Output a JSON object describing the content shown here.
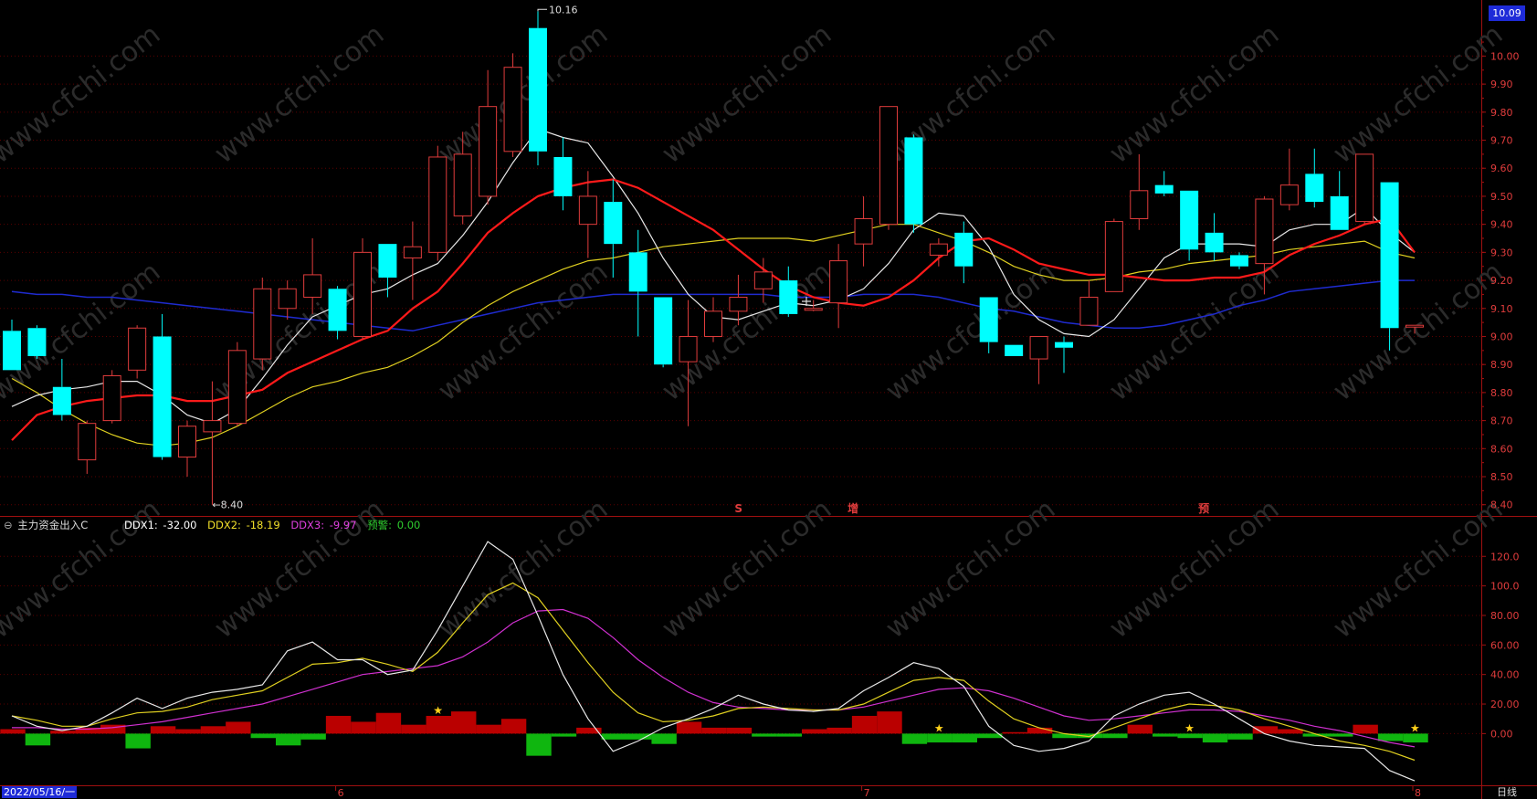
{
  "chart_data": [
    {
      "type": "candlestick",
      "price_axis": {
        "ticks": [
          "10.00",
          "9.90",
          "9.80",
          "9.70",
          "9.60",
          "9.50",
          "9.40",
          "9.30",
          "9.20",
          "9.10",
          "9.00",
          "8.90",
          "8.80",
          "8.70",
          "8.60",
          "8.50",
          "8.40"
        ],
        "range": [
          8.36,
          10.2
        ]
      },
      "current_price_label": "10.09",
      "max_marker": "10.16",
      "min_marker": "8.40",
      "candles": [
        {
          "o": 9.02,
          "h": 9.06,
          "l": 8.88,
          "c": 8.88
        },
        {
          "o": 9.03,
          "h": 9.04,
          "l": 8.92,
          "c": 8.93
        },
        {
          "o": 8.82,
          "h": 8.92,
          "l": 8.7,
          "c": 8.72
        },
        {
          "o": 8.56,
          "h": 8.7,
          "l": 8.51,
          "c": 8.69
        },
        {
          "o": 8.7,
          "h": 8.88,
          "l": 8.69,
          "c": 8.86
        },
        {
          "o": 8.88,
          "h": 9.04,
          "l": 8.85,
          "c": 9.03
        },
        {
          "o": 9.0,
          "h": 9.08,
          "l": 8.56,
          "c": 8.57
        },
        {
          "o": 8.57,
          "h": 8.7,
          "l": 8.5,
          "c": 8.68
        },
        {
          "o": 8.66,
          "h": 8.84,
          "l": 8.4,
          "c": 8.7
        },
        {
          "o": 8.69,
          "h": 8.98,
          "l": 8.68,
          "c": 8.95
        },
        {
          "o": 8.92,
          "h": 9.21,
          "l": 8.88,
          "c": 9.17
        },
        {
          "o": 9.1,
          "h": 9.2,
          "l": 9.06,
          "c": 9.17
        },
        {
          "o": 9.14,
          "h": 9.35,
          "l": 9.08,
          "c": 9.22
        },
        {
          "o": 9.17,
          "h": 9.18,
          "l": 8.99,
          "c": 9.02
        },
        {
          "o": 9.0,
          "h": 9.35,
          "l": 8.99,
          "c": 9.3
        },
        {
          "o": 9.33,
          "h": 9.33,
          "l": 9.14,
          "c": 9.21
        },
        {
          "o": 9.28,
          "h": 9.41,
          "l": 9.13,
          "c": 9.32
        },
        {
          "o": 9.3,
          "h": 9.68,
          "l": 9.27,
          "c": 9.64
        },
        {
          "o": 9.43,
          "h": 9.73,
          "l": 9.4,
          "c": 9.65
        },
        {
          "o": 9.5,
          "h": 9.95,
          "l": 9.47,
          "c": 9.82
        },
        {
          "o": 9.66,
          "h": 10.01,
          "l": 9.64,
          "c": 9.96
        },
        {
          "o": 10.1,
          "h": 10.16,
          "l": 9.61,
          "c": 9.66
        },
        {
          "o": 9.64,
          "h": 9.71,
          "l": 9.45,
          "c": 9.5
        },
        {
          "o": 9.4,
          "h": 9.59,
          "l": 9.28,
          "c": 9.5
        },
        {
          "o": 9.48,
          "h": 9.56,
          "l": 9.21,
          "c": 9.33
        },
        {
          "o": 9.3,
          "h": 9.38,
          "l": 9.0,
          "c": 9.16
        },
        {
          "o": 9.14,
          "h": 9.14,
          "l": 8.89,
          "c": 8.9
        },
        {
          "o": 8.91,
          "h": 9.13,
          "l": 8.68,
          "c": 9.0
        },
        {
          "o": 9.0,
          "h": 9.14,
          "l": 8.98,
          "c": 9.09
        },
        {
          "o": 9.09,
          "h": 9.22,
          "l": 9.04,
          "c": 9.14
        },
        {
          "o": 9.17,
          "h": 9.28,
          "l": 9.12,
          "c": 9.23
        },
        {
          "o": 9.2,
          "h": 9.25,
          "l": 9.07,
          "c": 9.08
        },
        {
          "o": 9.1,
          "h": 9.13,
          "l": 9.09,
          "c": 9.1
        },
        {
          "o": 9.12,
          "h": 9.33,
          "l": 9.03,
          "c": 9.27
        },
        {
          "o": 9.33,
          "h": 9.5,
          "l": 9.25,
          "c": 9.42
        },
        {
          "o": 9.4,
          "h": 9.82,
          "l": 9.38,
          "c": 9.82
        },
        {
          "o": 9.71,
          "h": 9.72,
          "l": 9.37,
          "c": 9.4
        },
        {
          "o": 9.29,
          "h": 9.35,
          "l": 9.25,
          "c": 9.33
        },
        {
          "o": 9.37,
          "h": 9.41,
          "l": 9.19,
          "c": 9.25
        },
        {
          "o": 9.14,
          "h": 9.14,
          "l": 8.94,
          "c": 8.98
        },
        {
          "o": 8.97,
          "h": 8.97,
          "l": 8.93,
          "c": 8.93
        },
        {
          "o": 8.92,
          "h": 9.0,
          "l": 8.83,
          "c": 9.0
        },
        {
          "o": 8.98,
          "h": 9.0,
          "l": 8.87,
          "c": 8.96
        },
        {
          "o": 9.04,
          "h": 9.2,
          "l": 9.04,
          "c": 9.14
        },
        {
          "o": 9.16,
          "h": 9.42,
          "l": 9.16,
          "c": 9.41
        },
        {
          "o": 9.42,
          "h": 9.65,
          "l": 9.38,
          "c": 9.52
        },
        {
          "o": 9.54,
          "h": 9.59,
          "l": 9.5,
          "c": 9.51
        },
        {
          "o": 9.52,
          "h": 9.52,
          "l": 9.27,
          "c": 9.31
        },
        {
          "o": 9.37,
          "h": 9.44,
          "l": 9.27,
          "c": 9.3
        },
        {
          "o": 9.29,
          "h": 9.3,
          "l": 9.24,
          "c": 9.25
        },
        {
          "o": 9.26,
          "h": 9.5,
          "l": 9.15,
          "c": 9.49
        },
        {
          "o": 9.47,
          "h": 9.67,
          "l": 9.45,
          "c": 9.54
        },
        {
          "o": 9.58,
          "h": 9.67,
          "l": 9.46,
          "c": 9.48
        },
        {
          "o": 9.5,
          "h": 9.59,
          "l": 9.38,
          "c": 9.38
        },
        {
          "o": 9.41,
          "h": 9.65,
          "l": 9.4,
          "c": 9.65
        },
        {
          "o": 9.55,
          "h": 9.55,
          "l": 8.95,
          "c": 9.03
        },
        {
          "o": 9.04,
          "h": 9.04,
          "l": 9.01,
          "c": 9.04
        }
      ],
      "ma_white": [
        8.75,
        8.79,
        8.81,
        8.82,
        8.84,
        8.84,
        8.79,
        8.72,
        8.69,
        8.74,
        8.85,
        8.97,
        9.07,
        9.11,
        9.15,
        9.17,
        9.22,
        9.26,
        9.36,
        9.48,
        9.62,
        9.74,
        9.71,
        9.69,
        9.57,
        9.44,
        9.28,
        9.15,
        9.07,
        9.06,
        9.09,
        9.12,
        9.11,
        9.13,
        9.17,
        9.26,
        9.38,
        9.44,
        9.43,
        9.32,
        9.15,
        9.06,
        9.01,
        9.0,
        9.06,
        9.17,
        9.28,
        9.33,
        9.33,
        9.33,
        9.32,
        9.38,
        9.4,
        9.4,
        9.46,
        9.37,
        9.3
      ],
      "ma_red": [
        8.63,
        8.72,
        8.75,
        8.77,
        8.78,
        8.79,
        8.79,
        8.77,
        8.77,
        8.79,
        8.81,
        8.87,
        8.91,
        8.95,
        8.99,
        9.02,
        9.1,
        9.16,
        9.26,
        9.37,
        9.44,
        9.5,
        9.53,
        9.55,
        9.56,
        9.53,
        9.48,
        9.43,
        9.38,
        9.31,
        9.24,
        9.18,
        9.14,
        9.12,
        9.11,
        9.14,
        9.2,
        9.28,
        9.34,
        9.35,
        9.31,
        9.26,
        9.24,
        9.22,
        9.22,
        9.21,
        9.2,
        9.2,
        9.21,
        9.21,
        9.23,
        9.29,
        9.33,
        9.36,
        9.4,
        9.42,
        9.3
      ],
      "ma_yellow": [
        8.85,
        8.8,
        8.74,
        8.69,
        8.65,
        8.62,
        8.61,
        8.62,
        8.64,
        8.68,
        8.73,
        8.78,
        8.82,
        8.84,
        8.87,
        8.89,
        8.93,
        8.98,
        9.05,
        9.11,
        9.16,
        9.2,
        9.24,
        9.27,
        9.28,
        9.3,
        9.32,
        9.33,
        9.34,
        9.35,
        9.35,
        9.35,
        9.34,
        9.36,
        9.38,
        9.4,
        9.4,
        9.37,
        9.34,
        9.3,
        9.25,
        9.22,
        9.2,
        9.2,
        9.21,
        9.23,
        9.24,
        9.26,
        9.27,
        9.28,
        9.29,
        9.31,
        9.32,
        9.33,
        9.34,
        9.3,
        9.28
      ],
      "ma_blue": [
        9.16,
        9.15,
        9.15,
        9.14,
        9.14,
        9.13,
        9.12,
        9.11,
        9.1,
        9.09,
        9.08,
        9.07,
        9.06,
        9.05,
        9.04,
        9.03,
        9.02,
        9.04,
        9.06,
        9.08,
        9.1,
        9.12,
        9.13,
        9.14,
        9.15,
        9.15,
        9.15,
        9.15,
        9.15,
        9.15,
        9.15,
        9.14,
        9.14,
        9.14,
        9.15,
        9.15,
        9.15,
        9.14,
        9.12,
        9.1,
        9.09,
        9.07,
        9.05,
        9.04,
        9.03,
        9.03,
        9.04,
        9.06,
        9.08,
        9.11,
        9.13,
        9.16,
        9.17,
        9.18,
        9.19,
        9.2,
        9.2
      ],
      "signal_marks": [
        "S",
        "增",
        "预"
      ]
    },
    {
      "type": "line",
      "title": "主力资金出入C",
      "legend": [
        {
          "label": "DDX1:",
          "value": "-32.00",
          "color": "#ffffff"
        },
        {
          "label": "DDX2:",
          "value": "-18.19",
          "color": "#f2e02a"
        },
        {
          "label": "DDX3:",
          "value": "-9.97",
          "color": "#e040e0"
        },
        {
          "label": "预警:",
          "value": "0.00",
          "color": "#2ecc2e"
        }
      ],
      "y_axis": {
        "ticks": [
          "120.0",
          "100.0",
          "80.00",
          "60.00",
          "40.00",
          "20.00",
          "0.00"
        ],
        "range": [
          -35,
          135
        ]
      },
      "series_white": [
        12,
        5,
        2,
        5,
        14,
        24,
        17,
        24,
        28,
        30,
        33,
        56,
        62,
        50,
        50,
        40,
        43,
        70,
        100,
        130,
        118,
        80,
        40,
        10,
        -12,
        -5,
        4,
        10,
        17,
        26,
        20,
        16,
        15,
        17,
        29,
        38,
        48,
        44,
        32,
        5,
        -8,
        -12,
        -10,
        -5,
        12,
        20,
        26,
        28,
        20,
        10,
        0,
        -5,
        -8,
        -9,
        -10,
        -25,
        -32
      ],
      "series_yellow": [
        12,
        9,
        5,
        5,
        10,
        14,
        15,
        18,
        23,
        26,
        29,
        38,
        47,
        48,
        51,
        47,
        42,
        55,
        75,
        94,
        102,
        92,
        70,
        48,
        28,
        14,
        8,
        9,
        12,
        17,
        18,
        17,
        16,
        16,
        20,
        28,
        36,
        38,
        36,
        22,
        10,
        4,
        0,
        -2,
        4,
        10,
        16,
        20,
        19,
        16,
        10,
        5,
        0,
        -5,
        -8,
        -12,
        -18
      ],
      "series_magenta": [
        4,
        4,
        3,
        3,
        4,
        6,
        8,
        11,
        14,
        17,
        20,
        25,
        30,
        35,
        40,
        42,
        44,
        46,
        52,
        62,
        75,
        83,
        84,
        78,
        65,
        50,
        38,
        28,
        21,
        18,
        17,
        16,
        16,
        16,
        18,
        22,
        26,
        30,
        31,
        29,
        24,
        18,
        12,
        9,
        10,
        12,
        14,
        16,
        16,
        15,
        12,
        9,
        5,
        2,
        -2,
        -6,
        -9
      ],
      "bars": [
        3,
        -8,
        2,
        4,
        6,
        -10,
        5,
        3,
        5,
        8,
        -3,
        -8,
        -4,
        12,
        8,
        14,
        6,
        12,
        15,
        6,
        10,
        -15,
        -2,
        4,
        -4,
        -4,
        -7,
        8,
        4,
        4,
        -2,
        -2,
        3,
        4,
        12,
        15,
        -7,
        -6,
        -6,
        -3,
        1,
        4,
        -3,
        -3,
        -3,
        6,
        -2,
        -3,
        -6,
        -4,
        5,
        3,
        -2,
        -2,
        6,
        -5,
        -6
      ],
      "star_marks": 5
    }
  ],
  "indicator_header": {
    "name": "主力资金出入C",
    "ddx1_label": "DDX1:",
    "ddx1_value": "-32.00",
    "ddx2_label": "DDX2:",
    "ddx2_value": "-18.19",
    "ddx3_label": "DDX3:",
    "ddx3_value": "-9.97",
    "warn_label": "预警:",
    "warn_value": "0.00"
  },
  "time_axis": {
    "start_date": "2022/05/16/一",
    "month_labels": [
      "6",
      "7",
      "8"
    ],
    "period": "日线"
  },
  "watermark": "www.cfchi.com",
  "colors": {
    "up": "#e03c3c",
    "down": "#00ffff",
    "ma_white": "#e8e8e8",
    "ma_red": "#ff1a1a",
    "ma_yellow": "#e0d020",
    "ma_blue": "#1f2bd0",
    "axis": "#a01010",
    "grid": "#5a0000"
  }
}
